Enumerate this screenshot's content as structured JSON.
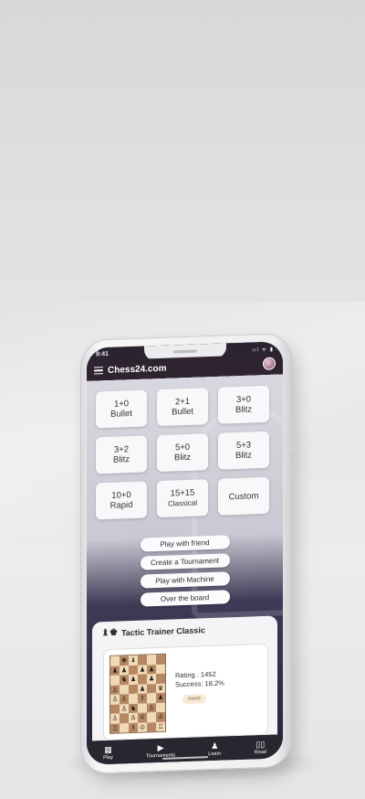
{
  "status": {
    "time": "9:41",
    "icons": "ııl ᯤ ▮"
  },
  "header": {
    "brand": "Chess24.com",
    "menu_icon": "hamburger-icon",
    "avatar": "user-avatar"
  },
  "time_controls": [
    {
      "time": "1+0",
      "mode": "Bullet"
    },
    {
      "time": "2+1",
      "mode": "Bullet"
    },
    {
      "time": "3+0",
      "mode": "Blitz"
    },
    {
      "time": "3+2",
      "mode": "Blitz"
    },
    {
      "time": "5+0",
      "mode": "Blitz"
    },
    {
      "time": "5+3",
      "mode": "Blitz"
    },
    {
      "time": "10+0",
      "mode": "Rapid"
    },
    {
      "time": "15+15",
      "mode": "Classical"
    },
    {
      "time": "",
      "mode": "Custom"
    }
  ],
  "actions": [
    "Play with friend",
    "Create a Tournament",
    "Play with Machine",
    "Over the board"
  ],
  "tactic": {
    "title": "Tactic Trainer Classic",
    "rating_label": "Rating : 1452",
    "success_label": "Success: 18.2%",
    "more": "more"
  },
  "tabs": [
    {
      "label": "Play",
      "icon": "board-icon"
    },
    {
      "label": "Tournaments",
      "icon": "trophy-icon"
    },
    {
      "label": "Learn",
      "icon": "learn-icon"
    },
    {
      "label": "Read",
      "icon": "book-icon"
    }
  ]
}
